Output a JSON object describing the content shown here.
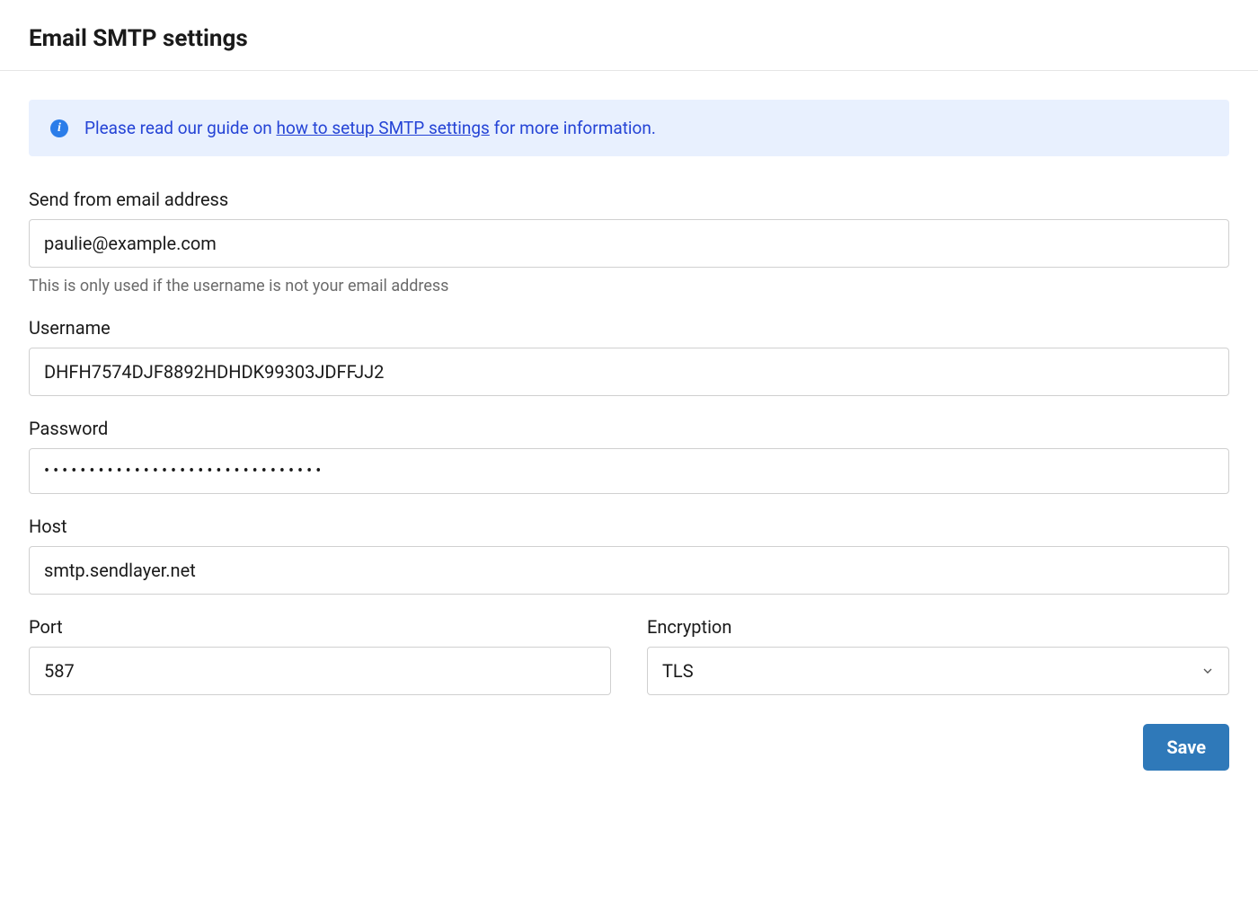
{
  "header": {
    "title": "Email SMTP settings"
  },
  "banner": {
    "text_prefix": "Please read our guide on ",
    "link_text": "how to setup SMTP settings",
    "text_suffix": " for more information."
  },
  "fields": {
    "from_email": {
      "label": "Send from email address",
      "value": "paulie@example.com",
      "help": "This is only used if the username is not your email address"
    },
    "username": {
      "label": "Username",
      "value": "DHFH7574DJF8892HDHDK99303JDFFJJ2"
    },
    "password": {
      "label": "Password",
      "value": "xxxxxxxxxxxxxxxxxxxxxxxxxxxxxxx"
    },
    "host": {
      "label": "Host",
      "value": "smtp.sendlayer.net"
    },
    "port": {
      "label": "Port",
      "value": "587"
    },
    "encryption": {
      "label": "Encryption",
      "value": "TLS"
    }
  },
  "actions": {
    "save_label": "Save"
  }
}
